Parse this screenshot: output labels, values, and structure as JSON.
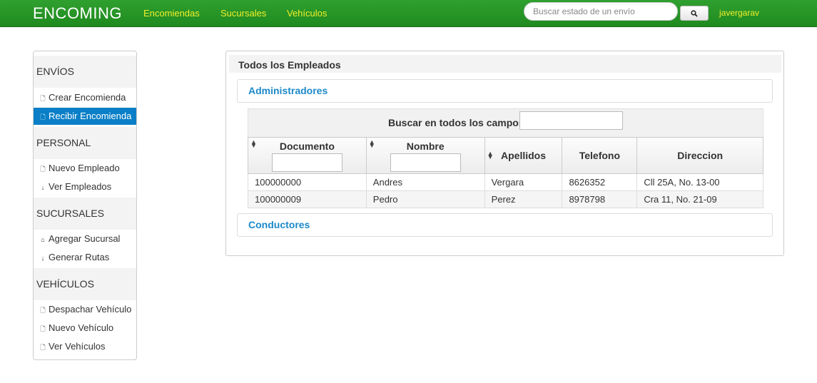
{
  "navbar": {
    "brand": "ENCOMING",
    "links": [
      "Encomiendas",
      "Sucursales",
      "Vehículos"
    ],
    "search_placeholder": "Buscar estado de un envío",
    "search_icon": "search-icon",
    "user": "javergarav"
  },
  "sidebar": {
    "sections": [
      {
        "title": "ENVÍOS",
        "items": [
          {
            "label": "Crear Encomienda",
            "icon": "file-icon"
          },
          {
            "label": "Recibir Encomienda",
            "icon": "file-icon",
            "active": true
          }
        ]
      },
      {
        "title": "PERSONAL",
        "items": [
          {
            "label": "Nuevo Empleado",
            "icon": "file-icon"
          },
          {
            "label": "Ver Empleados",
            "icon": "arrow-down-icon"
          }
        ]
      },
      {
        "title": "SUCURSALES",
        "items": [
          {
            "label": "Agregar Sucursal",
            "icon": "home-icon"
          },
          {
            "label": "Generar Rutas",
            "icon": "arrow-down-icon"
          }
        ]
      },
      {
        "title": "VEHÍCULOS",
        "items": [
          {
            "label": "Despachar Vehículo",
            "icon": "file-icon"
          },
          {
            "label": "Nuevo Vehículo",
            "icon": "file-icon"
          },
          {
            "label": "Ver Vehículos",
            "icon": "file-icon"
          }
        ]
      }
    ],
    "active_color": "#0a7fc7"
  },
  "main": {
    "title": "Todos los Empleados",
    "sections": [
      "Administradores",
      "Conductores"
    ],
    "filter_label": "Buscar en todos los campos:",
    "table": {
      "headers": [
        "Documento",
        "Nombre",
        "Apellidos",
        "Telefono",
        "Direccion"
      ],
      "rows": [
        [
          "100000000",
          "Andres",
          "Vergara",
          "8626352",
          "Cll 25A, No. 13-00"
        ],
        [
          "100000009",
          "Pedro",
          "Perez",
          "8978798",
          "Cra 11, No. 21-09"
        ]
      ]
    }
  },
  "colors": {
    "navbar_green": "#24921f",
    "nav_link_yellow": "#f2ee2a",
    "section_link_blue": "#1d89c9"
  }
}
